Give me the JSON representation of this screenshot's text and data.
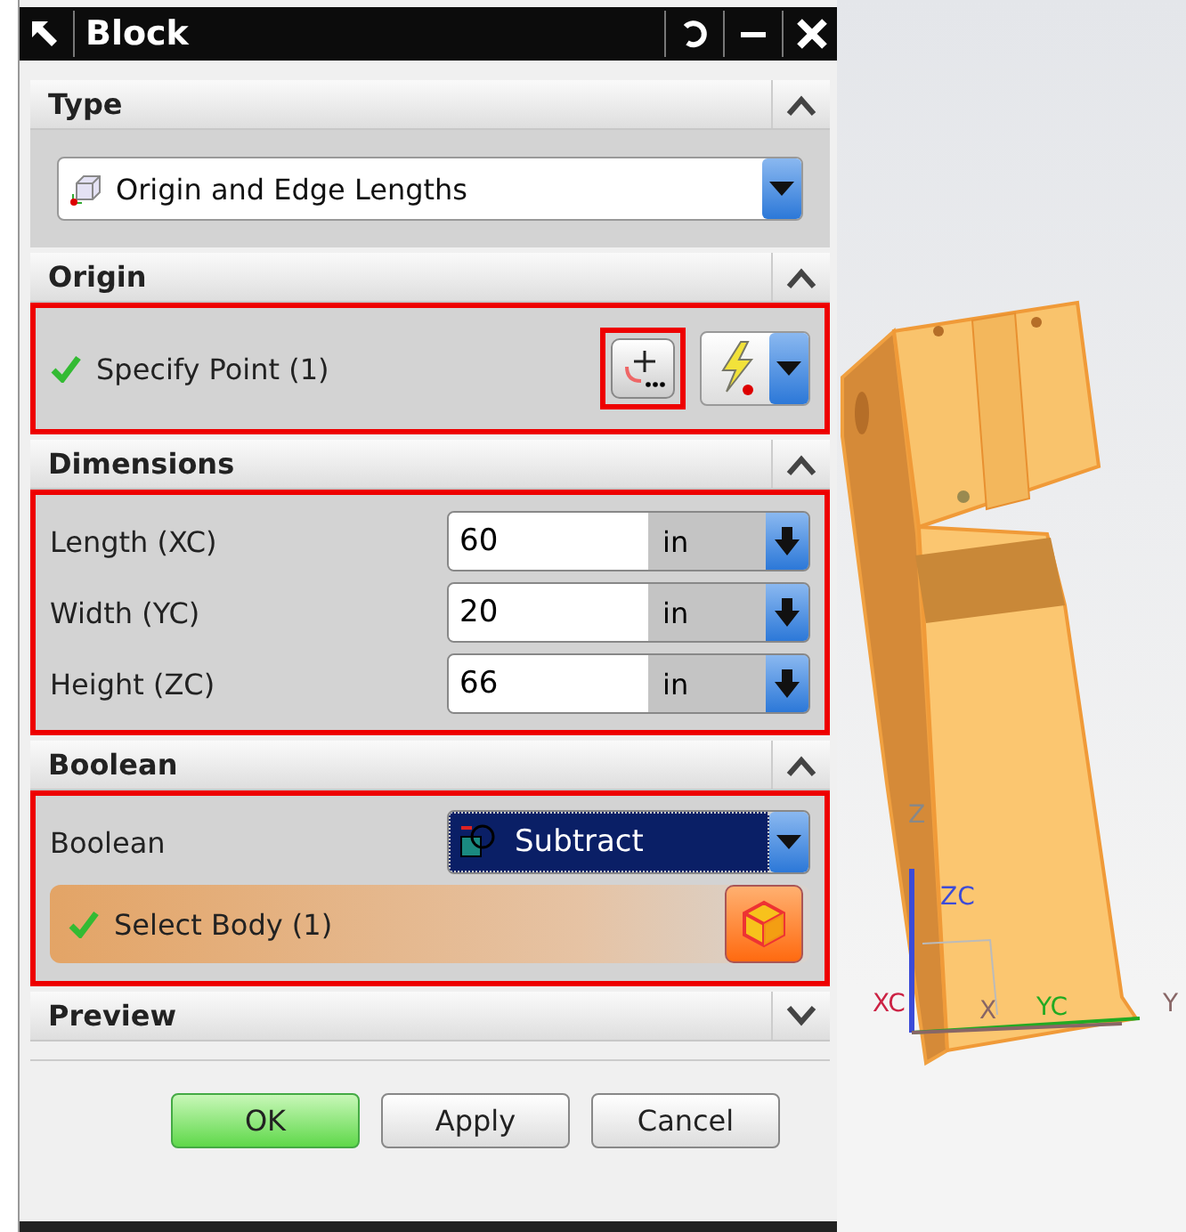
{
  "window": {
    "title": "Block"
  },
  "sections": [
    {
      "kind": "type",
      "title": "Type",
      "expanded": true,
      "value": "Origin and Edge Lengths"
    },
    {
      "kind": "point",
      "title": "Origin",
      "expanded": true,
      "highlighted": true,
      "label": "Specify Point (1)",
      "complete": true,
      "point_button_highlighted": true
    },
    {
      "kind": "dimensions",
      "title": "Dimensions",
      "expanded": true,
      "highlighted": true,
      "rows": [
        {
          "label": "Length (XC)",
          "value": "60",
          "unit": "in"
        },
        {
          "label": "Width (YC)",
          "value": "20",
          "unit": "in"
        },
        {
          "label": "Height (ZC)",
          "value": "66",
          "unit": "in"
        }
      ]
    },
    {
      "kind": "boolean",
      "title": "Boolean",
      "expanded": true,
      "highlighted": true,
      "label": "Boolean",
      "value": "Subtract",
      "select_label": "Select Body (1)",
      "complete": true
    },
    {
      "title": "Preview",
      "expanded": false
    }
  ],
  "buttons": [
    {
      "label": "OK",
      "default": true
    },
    {
      "label": "Apply",
      "default": false
    },
    {
      "label": "Cancel",
      "default": false
    }
  ],
  "viewport": {
    "axis_labels": [
      "Z",
      "ZC",
      "XC",
      "X",
      "YC",
      "Y"
    ]
  }
}
